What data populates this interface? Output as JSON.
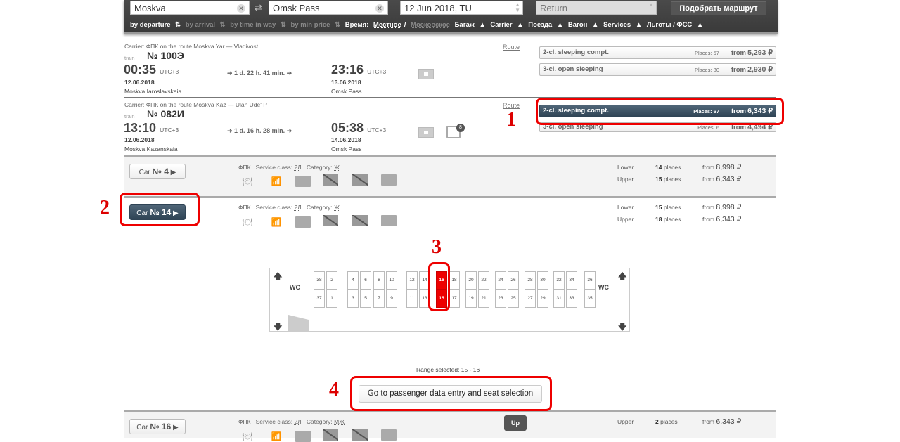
{
  "search": {
    "from": "Moskva",
    "to": "Omsk Pass",
    "date": "12 Jun 2018, TU",
    "return_placeholder": "Return",
    "submit": "Подобрать маршрут"
  },
  "sort": {
    "by_departure": "by departure",
    "by_arrival": "by arrival",
    "by_time": "by time in way",
    "by_price": "by min price",
    "time_label": "Время:",
    "time_local": "Местное",
    "time_moscow": "Московское",
    "filters": [
      "Багаж",
      "Carrier",
      "Поезда",
      "Вагон",
      "Services",
      "Льготы / ФСС"
    ]
  },
  "trains": [
    {
      "carrier": "Carrier: ФПК    on the route Moskva Yar — Vladivost",
      "train_label": "train",
      "number": "№ 100Э",
      "dep_time": "00:35",
      "dep_tz": "UTC+3",
      "dep_date": "12.06.2018",
      "dep_station": "Moskva Iaroslavskaia",
      "duration": "1 d. 22 h. 41 min.",
      "arr_time": "23:16",
      "arr_tz": "UTC+3",
      "arr_date": "13.06.2018",
      "arr_station": "Omsk Pass",
      "route": "Route",
      "classes": [
        {
          "name": "2-cl. sleeping compt.",
          "places": "Places: 57",
          "from": "from",
          "price": "5,293 ₽"
        },
        {
          "name": "3-cl. open sleeping",
          "places": "Places: 80",
          "from": "from",
          "price": "2,930 ₽"
        }
      ]
    },
    {
      "carrier": "Carrier: ФПК    on the route Moskva Kaz — Ulan Ude' P",
      "train_label": "train",
      "number": "№ 082И",
      "dep_time": "13:10",
      "dep_tz": "UTC+3",
      "dep_date": "12.06.2018",
      "dep_station": "Moskva Kazanskaia",
      "duration": "1 d. 16 h. 28 min.",
      "arr_time": "05:38",
      "arr_tz": "UTC+3",
      "arr_date": "14.06.2018",
      "arr_station": "Omsk Pass",
      "route": "Route",
      "badge": "8",
      "classes": [
        {
          "name": "2-cl. sleeping compt.",
          "places": "Places: 67",
          "from": "from",
          "price": "6,343 ₽",
          "selected": true
        },
        {
          "name": "3-cl. open sleeping",
          "places": "Places: 6",
          "from": "from",
          "price": "4,494 ₽"
        }
      ]
    }
  ],
  "cars": [
    {
      "car": "Car",
      "number": "№ 4",
      "carrier": "ФПК",
      "svc_label": "Service class:",
      "svc": "2Л",
      "cat_label": "Category:",
      "cat": "Ж",
      "berths": [
        {
          "type": "Lower",
          "count": "14",
          "unit": "places",
          "from": "from",
          "price": "8,998 ₽"
        },
        {
          "type": "Upper",
          "count": "15",
          "unit": "places",
          "from": "from",
          "price": "6,343 ₽"
        }
      ]
    },
    {
      "car": "Car",
      "number": "№ 14",
      "carrier": "ФПК",
      "svc_label": "Service class:",
      "svc": "2Л",
      "cat_label": "Category:",
      "cat": "Ж",
      "selected": true,
      "berths": [
        {
          "type": "Lower",
          "count": "15",
          "unit": "places",
          "from": "from",
          "price": "8,998 ₽"
        },
        {
          "type": "Upper",
          "count": "18",
          "unit": "places",
          "from": "from",
          "price": "6,343 ₽"
        }
      ]
    },
    {
      "car": "Car",
      "number": "№ 16",
      "carrier": "ФПК",
      "svc_label": "Service class:",
      "svc": "2Л",
      "cat_label": "Category:",
      "cat": "МЖ",
      "berths": [
        {
          "type": "Upper",
          "count": "2",
          "unit": "places",
          "from": "from",
          "price": "6,343 ₽"
        }
      ]
    }
  ],
  "plan": {
    "wc": "WC",
    "upper_seats": [
      "38",
      "2",
      "4",
      "6",
      "8",
      "10",
      "12",
      "14",
      "16",
      "18",
      "20",
      "22",
      "24",
      "26",
      "28",
      "30",
      "32",
      "34",
      "36"
    ],
    "lower_seats": [
      "37",
      "1",
      "3",
      "5",
      "7",
      "9",
      "11",
      "13",
      "15",
      "17",
      "19",
      "21",
      "23",
      "25",
      "27",
      "29",
      "31",
      "33",
      "35"
    ],
    "selected": [
      "15",
      "16"
    ]
  },
  "range_selected": "Range selected: 15 - 16",
  "go_button": "Go to passenger data entry and seat selection",
  "up_button": "Up",
  "annotations": [
    "1",
    "2",
    "3",
    "4"
  ]
}
